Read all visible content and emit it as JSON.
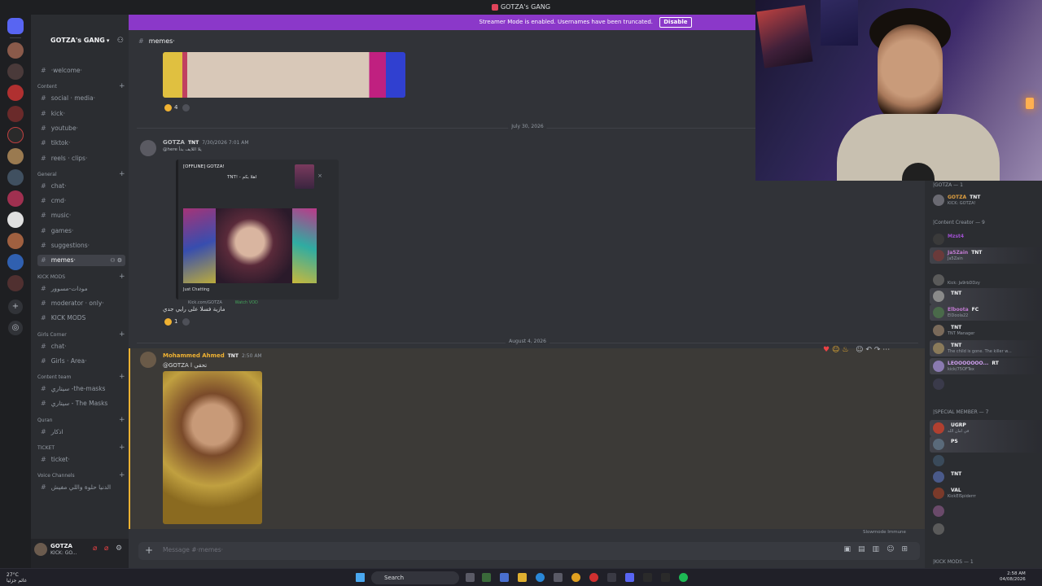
{
  "window": {
    "title": "GOTZA's GANG"
  },
  "banner": {
    "text": "Streamer Mode is enabled. Usernames have been truncated.",
    "button": "Disable"
  },
  "server": {
    "name": "GOTZA's GANG"
  },
  "channels": [
    {
      "type": "channel",
      "label": "·welcome·"
    },
    {
      "type": "category",
      "label": "Content"
    },
    {
      "type": "channel",
      "label": "social · media·"
    },
    {
      "type": "channel",
      "label": "kick·"
    },
    {
      "type": "channel",
      "label": "youtube·"
    },
    {
      "type": "channel",
      "label": "tiktok·"
    },
    {
      "type": "channel",
      "label": "reels · clips·"
    },
    {
      "type": "category",
      "label": "General"
    },
    {
      "type": "channel",
      "label": "chat·"
    },
    {
      "type": "channel",
      "label": "cmd·"
    },
    {
      "type": "channel",
      "label": "music·"
    },
    {
      "type": "channel",
      "label": "games·"
    },
    {
      "type": "channel",
      "label": "suggestions·"
    },
    {
      "type": "channel",
      "label": "memes·",
      "active": true
    },
    {
      "type": "category",
      "label": "KICK MODS"
    },
    {
      "type": "channel",
      "label": "مودات-مسوور"
    },
    {
      "type": "channel",
      "label": "moderator · only·"
    },
    {
      "type": "channel",
      "label": "KICK MODS"
    },
    {
      "type": "category",
      "label": "Girls Corner"
    },
    {
      "type": "channel",
      "label": "chat·"
    },
    {
      "type": "channel",
      "label": "Girls · Area·"
    },
    {
      "type": "category",
      "label": "Content team"
    },
    {
      "type": "channel",
      "label": "سيتاري -the-masks"
    },
    {
      "type": "channel",
      "label": "سيتاري - The Masks"
    },
    {
      "type": "category",
      "label": "Quran"
    },
    {
      "type": "channel",
      "label": "اذكار"
    },
    {
      "type": "category",
      "label": "TICKET"
    },
    {
      "type": "channel",
      "label": "ticket·"
    },
    {
      "type": "category",
      "label": "Voice Channels"
    },
    {
      "type": "channel",
      "label": "الدنيا حلوة واللي مفيش"
    }
  ],
  "user_panel": {
    "name": "GOTZA",
    "status": "KICK: GO..."
  },
  "chat": {
    "channel": "memes·",
    "reaction_1_count": "4",
    "date_1": "July 30, 2026",
    "msg1": {
      "author": "GOTZA",
      "role": "TNT",
      "time": "7/30/2026 7:01 AM",
      "reply": "@here يلا اللايف بدأ",
      "embed_head": "[OFFLINE] GOTZA!",
      "embed_title": "TNT! - اهلا بكم",
      "embed_caption": "Just Chatting",
      "embed_link": "Kick.com/GOTZA",
      "embed_vod": "Watch VOD",
      "text": "مازية فسلا على رايي جدي",
      "reaction_count": "1"
    },
    "date_2": "August 4, 2026",
    "msg2": {
      "author": "Mohammed Ahmed",
      "role": "TNT",
      "time": "2:50 AM",
      "text": "@GOTZA تحقي ا"
    },
    "composer_placeholder": "Message #·memes·",
    "slowmode": "Slowmode Immune"
  },
  "members": {
    "cat_1": "|GOTZA — 1",
    "cat_2": "|Content Creator — 9",
    "cat_3": "|SPECIAL MEMBER — 7",
    "cat_4": "|KICK MODS — 1",
    "list": [
      {
        "name": "GOTZA",
        "tag": "TNT",
        "status": "KICK: GOTZA!",
        "color": "#e0a040"
      },
      {
        "name": "Mzst4",
        "tag": "",
        "status": "",
        "color": "#a050d0"
      },
      {
        "name": "Ja5Zain",
        "tag": "TNT",
        "status": "Ja5Zain",
        "color": "#c07ad0"
      },
      {
        "name": "",
        "tag": "",
        "status": "Kick: Ja9rbDDzy",
        "color": "#8a8a8a"
      },
      {
        "name": "",
        "tag": "TNT",
        "status": "",
        "color": "#c07ad0"
      },
      {
        "name": "Elboota",
        "tag": "FC",
        "status": "ElDoola22",
        "color": "#c07ad0"
      },
      {
        "name": "",
        "tag": "TNT",
        "status": "TNT Manager",
        "color": "#c07ad0"
      },
      {
        "name": "",
        "tag": "TNT",
        "status": "The child is gone. The killer w...",
        "color": "#c07ad0"
      },
      {
        "name": "LEOOOOOOO...",
        "tag": "RT",
        "status": "kick/75OFTex",
        "color": "#d0a0f0"
      },
      {
        "name": "",
        "tag": "",
        "status": "",
        "color": "#c07ad0"
      },
      {
        "name": "",
        "tag": "UGRP",
        "status": "في امان الله",
        "color": "#e04040"
      },
      {
        "name": "",
        "tag": "PS",
        "status": "",
        "color": "#6060f0"
      },
      {
        "name": "",
        "tag": "",
        "status": "",
        "color": "#6060f0"
      },
      {
        "name": "",
        "tag": "TNT",
        "status": "",
        "color": "#6060f0"
      },
      {
        "name": "",
        "tag": "VAL",
        "status": "KickElSpiderrr",
        "color": "#6060f0"
      },
      {
        "name": "",
        "tag": "",
        "status": "",
        "color": "#6060f0"
      },
      {
        "name": "",
        "tag": "",
        "status": "",
        "color": "#6060f0"
      }
    ]
  },
  "taskbar": {
    "weather_temp": "27°C",
    "weather_desc": "غائم جزئيا",
    "search": "Search",
    "time": "2:58 AM",
    "date": "04/08/2026"
  }
}
